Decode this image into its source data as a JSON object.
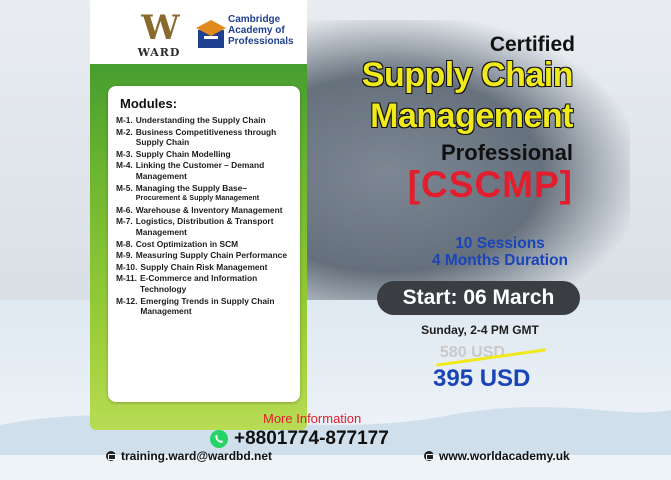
{
  "logos": {
    "ward_mark": "W",
    "ward_text": "WARD",
    "cambridge_lines": [
      "Cambridge",
      "Academy of",
      "Professionals"
    ]
  },
  "modules": {
    "heading": "Modules:",
    "items": [
      {
        "code": "M-1.",
        "title": "Understanding the Supply Chain",
        "sub": ""
      },
      {
        "code": "M-2.",
        "title": "Business Competitiveness through Supply Chain",
        "sub": ""
      },
      {
        "code": "M-3.",
        "title": "Supply Chain Modelling",
        "sub": ""
      },
      {
        "code": "M-4.",
        "title": "Linking the Customer – Demand Management",
        "sub": ""
      },
      {
        "code": "M-5.",
        "title": "Managing the Supply Base–",
        "sub": "Procurement & Supply Management"
      },
      {
        "code": "M-6.",
        "title": "Warehouse & Inventory Management",
        "sub": ""
      },
      {
        "code": "M-7.",
        "title": "Logistics, Distribution & Transport Management",
        "sub": ""
      },
      {
        "code": "M-8.",
        "title": "Cost Optimization in SCM",
        "sub": ""
      },
      {
        "code": "M-9.",
        "title": "Measuring Supply Chain Performance",
        "sub": ""
      },
      {
        "code": "M-10.",
        "title": "Supply Chain Risk Management",
        "sub": ""
      },
      {
        "code": "M-11.",
        "title": "E-Commerce and Information Technology",
        "sub": ""
      },
      {
        "code": "M-12.",
        "title": "Emerging Trends in Supply Chain Management",
        "sub": ""
      }
    ]
  },
  "headline": {
    "certified": "Certified",
    "line1": "Supply Chain",
    "line2": "Management",
    "professional": "Professional",
    "acronym": "[CSCMP]"
  },
  "course": {
    "sessions": "10 Sessions",
    "duration": "4 Months Duration",
    "start": "Start: 06 March",
    "schedule": "Sunday, 2-4 PM GMT",
    "old_price": "580 USD",
    "new_price": "395 USD"
  },
  "contact": {
    "more_info": "More Information",
    "phone": "+8801774-877177",
    "email": "training.ward@wardbd.net",
    "website": "www.worldacademy.uk"
  },
  "colors": {
    "accent_yellow": "#f0e91b",
    "accent_red": "#e21d2d",
    "accent_blue": "#1a45b8",
    "panel_green": "#6cb52f"
  }
}
